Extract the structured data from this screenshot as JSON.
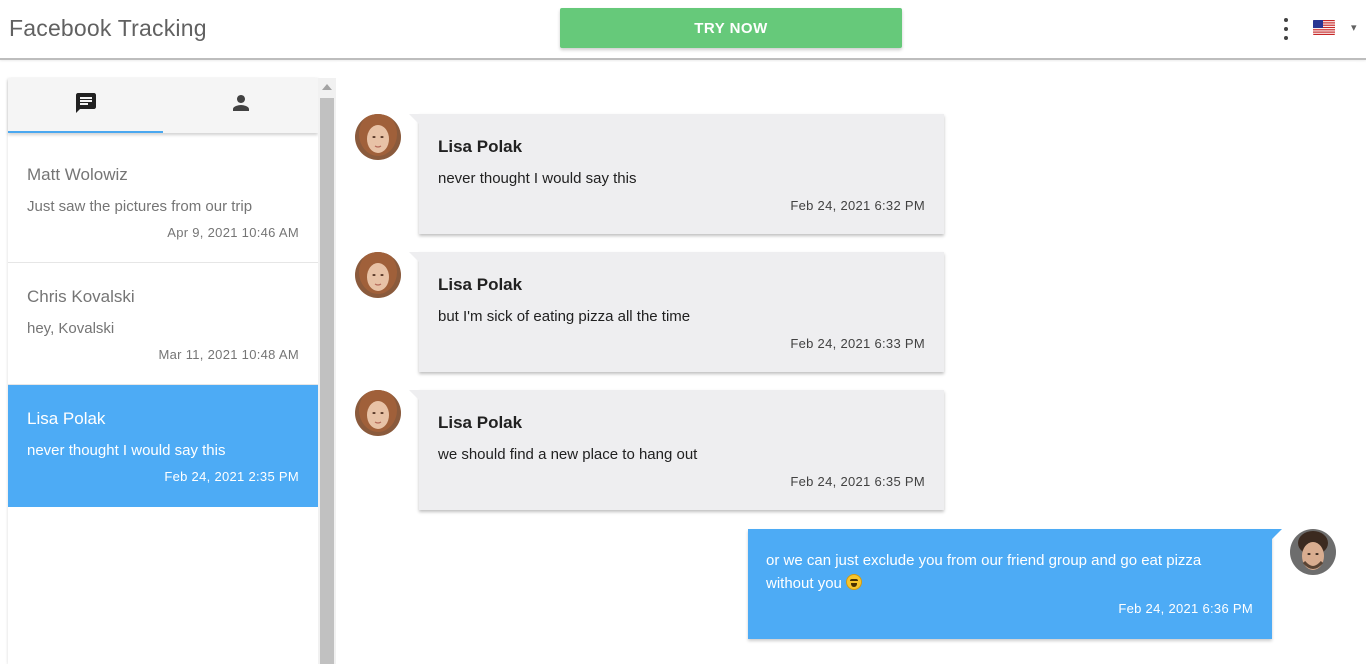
{
  "header": {
    "title": "Facebook Tracking",
    "try_label": "TRY NOW",
    "menu_icon": "more-vert-icon",
    "flag_icon": "us-flag-icon"
  },
  "sidebar": {
    "tabs": [
      {
        "icon": "chat-icon",
        "active": true
      },
      {
        "icon": "person-icon",
        "active": false
      }
    ],
    "conversations": [
      {
        "name": "Matt Wolowiz",
        "preview": "Just saw the pictures from our trip",
        "date": "Apr 9, 2021 10:46 AM"
      },
      {
        "name": "Chris Kovalski",
        "preview": "hey, Kovalski",
        "date": "Mar 11, 2021 10:48 AM"
      },
      {
        "name": "Lisa Polak",
        "preview": "never thought I would say this",
        "date": "Feb 24, 2021 2:35 PM"
      }
    ]
  },
  "chat": {
    "messages": [
      {
        "sender": "Lisa Polak",
        "text": "never thought I would say this",
        "time": "Feb 24, 2021 6:32 PM"
      },
      {
        "sender": "Lisa Polak",
        "text": "but I'm sick of eating pizza all the time",
        "time": "Feb 24, 2021 6:33 PM"
      },
      {
        "sender": "Lisa Polak",
        "text": "we should find a new place to hang out",
        "time": "Feb 24, 2021 6:35 PM"
      }
    ],
    "outgoing": {
      "text_line1": "or we can just exclude you from our friend group and go eat pizza",
      "text_line2": "without you",
      "time": "Feb 24, 2021 6:36 PM"
    }
  },
  "colors": {
    "accent": "#4dabf5",
    "try_button": "#66c97a",
    "bubble_in": "#eeeef0"
  }
}
